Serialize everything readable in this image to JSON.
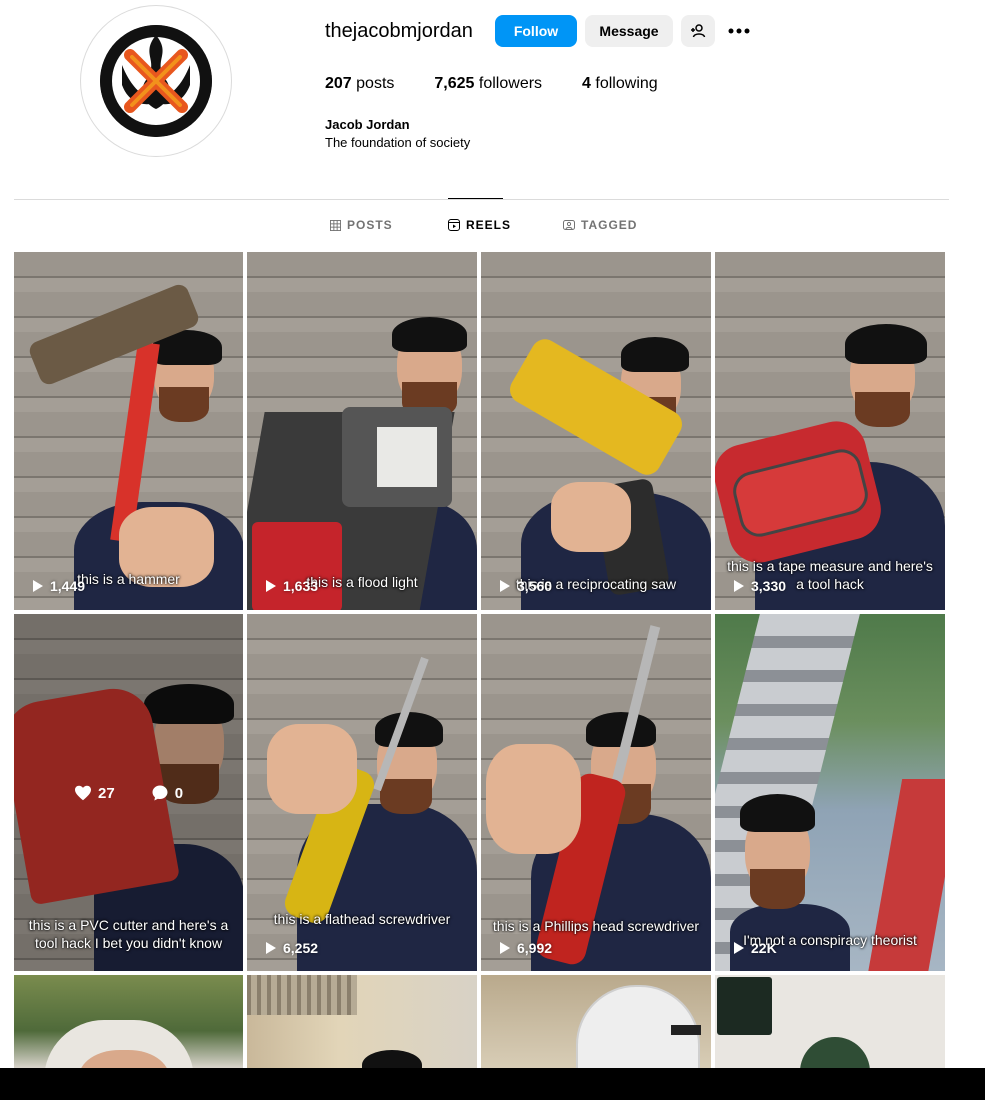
{
  "profile": {
    "username": "thejacobmjordan",
    "full_name": "Jacob Jordan",
    "bio": "The foundation of society",
    "posts_count": "207",
    "posts_label": "posts",
    "followers_count": "7,625",
    "followers_label": "followers",
    "following_count": "4",
    "following_label": "following"
  },
  "actions": {
    "follow": "Follow",
    "message": "Message"
  },
  "tabs": [
    {
      "label": "POSTS",
      "icon": "grid-icon"
    },
    {
      "label": "REELS",
      "icon": "reels-icon",
      "active": true
    },
    {
      "label": "TAGGED",
      "icon": "tagged-icon"
    }
  ],
  "reels": [
    {
      "caption": "this is a hammer",
      "views": "1,449"
    },
    {
      "caption": "this is a flood light",
      "views": "1,633"
    },
    {
      "caption": "this is a reciprocating saw",
      "views": "3,560"
    },
    {
      "caption": "this is a tape measure and here's a tool hack",
      "views": "3,330"
    },
    {
      "caption": "this is a PVC cutter and here's a tool hack I bet you didn't know",
      "likes": "27",
      "comments": "0"
    },
    {
      "caption": "this is a flathead screwdriver",
      "views": "6,252"
    },
    {
      "caption": "this is a Phillips head screwdriver",
      "views": "6,992"
    },
    {
      "caption": "I'm not a conspiracy theorist",
      "views": "22K"
    }
  ],
  "colors": {
    "follow_button": "#0095f6",
    "secondary_button": "#efefef",
    "divider": "#dbdbdb",
    "muted_text": "#737373"
  }
}
